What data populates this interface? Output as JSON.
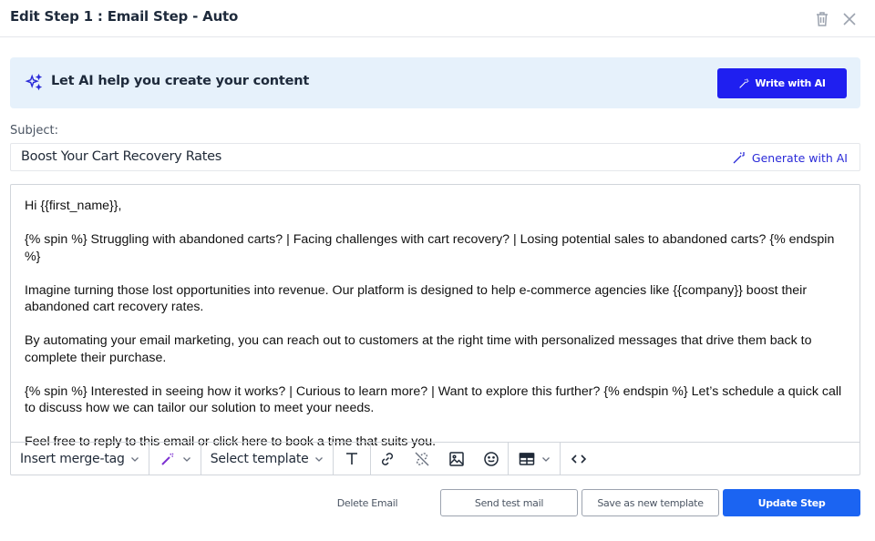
{
  "header": {
    "title": "Edit Step 1 : Email Step - Auto"
  },
  "ai_banner": {
    "text": "Let AI help you create your content",
    "button_label": "Write with AI"
  },
  "subject": {
    "label": "Subject:",
    "value": "Boost Your Cart Recovery Rates",
    "generate_label": "Generate with AI"
  },
  "editor": {
    "paragraphs": [
      "Hi {{first_name}},",
      "{% spin %} Struggling with abandoned carts? | Facing challenges with cart recovery? | Losing potential sales to abandoned carts? {% endspin %}",
      "Imagine turning those lost opportunities into revenue. Our platform is designed to help e-commerce agencies like {{company}} boost their abandoned cart recovery rates.",
      "By automating your email marketing, you can reach out to customers at the right time with personalized messages that drive them back to complete their purchase.",
      "{% spin %} Interested in seeing how it works? | Curious to learn more? | Want to explore this further? {% endspin %} Let’s schedule a quick call to discuss how we can tailor our solution to meet your needs.",
      "Feel free to reply to this email or click here to book a time that suits you."
    ]
  },
  "toolbar": {
    "merge_tag_label": "Insert merge-tag",
    "template_label": "Select template"
  },
  "footer": {
    "delete_label": "Delete Email",
    "send_test_label": "Send test mail",
    "save_template_label": "Save as new template",
    "update_label": "Update Step"
  },
  "colors": {
    "primary": "#1b64f2",
    "ai_button": "#1f1ff0",
    "banner_bg": "#e6f1fb",
    "ai_accent": "#2a2ad8"
  }
}
